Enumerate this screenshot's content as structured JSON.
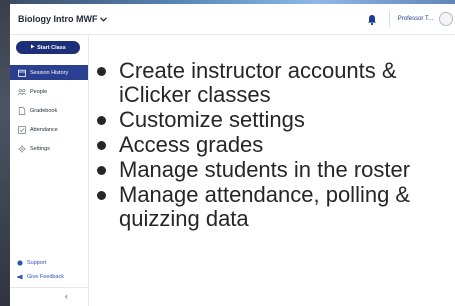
{
  "header": {
    "course_title": "Biology Intro MWF",
    "profile_label": "Professor T..."
  },
  "sidebar": {
    "start_button_label": "Start Class",
    "items": [
      {
        "label": "Session History",
        "icon": "calendar-icon",
        "active": true
      },
      {
        "label": "People",
        "icon": "people-icon",
        "active": false
      },
      {
        "label": "Gradebook",
        "icon": "document-icon",
        "active": false
      },
      {
        "label": "Attendance",
        "icon": "checkbox-icon",
        "active": false
      },
      {
        "label": "Settings",
        "icon": "gear-icon",
        "active": false
      }
    ],
    "footer": {
      "support_label": "Support",
      "feedback_label": "Give Feedback",
      "collapse_glyph": "‹"
    }
  },
  "main": {
    "bullets": [
      "Create instructor accounts & iClicker classes",
      "Customize settings",
      "Access grades",
      "Manage students in the roster",
      "Manage attendance, polling & quizzing data"
    ]
  },
  "colors": {
    "brand_navy": "#1d2f78",
    "active_nav": "#2a3f8f",
    "link_blue": "#2a56b8"
  }
}
